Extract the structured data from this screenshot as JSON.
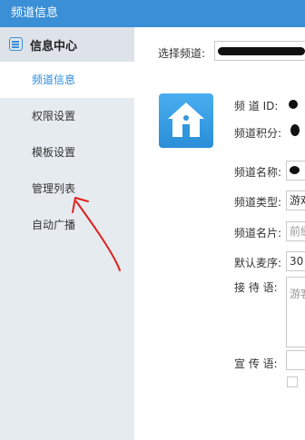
{
  "window": {
    "title": "频道信息"
  },
  "sidebar": {
    "header": "信息中心",
    "items": [
      {
        "label": "频道信息",
        "active": true
      },
      {
        "label": "权限设置",
        "active": false
      },
      {
        "label": "模板设置",
        "active": false
      },
      {
        "label": "管理列表",
        "active": false
      },
      {
        "label": "自动广播",
        "active": false
      }
    ]
  },
  "main": {
    "select_channel_label": "选择频道:",
    "channel_id_label": "频 道 ID:",
    "channel_points_label": "频道积分:",
    "channel_name_label": "频道名称:",
    "channel_type_label": "频道类型:",
    "channel_type_value": "游戏",
    "channel_card_label": "频道名片:",
    "channel_card_placeholder": "前缀",
    "default_mic_label": "默认麦序:",
    "default_mic_value": "30",
    "greeting_label": "接 待 语:",
    "greeting_placeholder": "游客",
    "slogan_label": "宣 传 语:"
  },
  "colors": {
    "accent": "#3a8fd6",
    "sidebar_bg": "#e6ebef",
    "active_text": "#2b8ad8",
    "annotation": "#e02020"
  },
  "icons": [
    "list-icon",
    "home-icon"
  ]
}
